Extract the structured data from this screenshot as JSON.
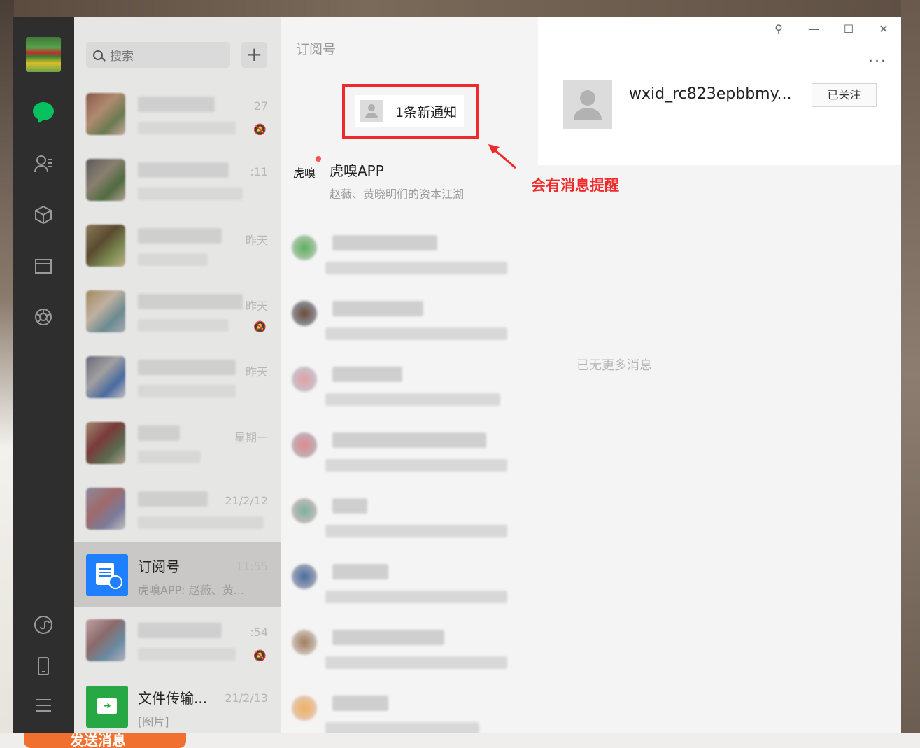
{
  "search": {
    "placeholder": "搜索",
    "add_label": "+"
  },
  "chats": [
    {
      "time": "27",
      "muted": true
    },
    {
      "time": ":11",
      "muted": false
    },
    {
      "time": "昨天",
      "muted": false
    },
    {
      "time": "昨天",
      "muted": true
    },
    {
      "time": "昨天",
      "muted": false
    },
    {
      "time": "星期一",
      "muted": false
    },
    {
      "time": "21/2/12",
      "muted": false
    },
    {
      "title": "订阅号",
      "time": "11:55",
      "preview": "虎嗅APP: 赵薇、黄...",
      "selected": true
    },
    {
      "time": ":54",
      "muted": true
    },
    {
      "title": "文件传输...",
      "time": "21/2/13",
      "preview": "[图片]"
    }
  ],
  "subscriptions": {
    "header": "订阅号",
    "notice": "1条新通知",
    "first": {
      "logo": "虎嗅",
      "title": "虎嗅APP",
      "preview": "赵薇、黄晓明们的资本江湖"
    }
  },
  "profile": {
    "wxid": "wxid_rc823epbbmy...",
    "follow_label": "已关注",
    "empty_text": "已无更多消息",
    "more_label": "···"
  },
  "window_controls": {
    "pin": "⚲",
    "minimize": "—",
    "maximize": "☐",
    "close": "✕"
  },
  "annotation": {
    "text": "会有消息提醒",
    "color": "#ef2a2a"
  },
  "background_button": {
    "label": "发送消息"
  },
  "colors": {
    "accent_green": "#07c160",
    "subscription_blue": "#1e80ff",
    "file_green": "#28a745",
    "highlight_red": "#ef2a2a"
  }
}
